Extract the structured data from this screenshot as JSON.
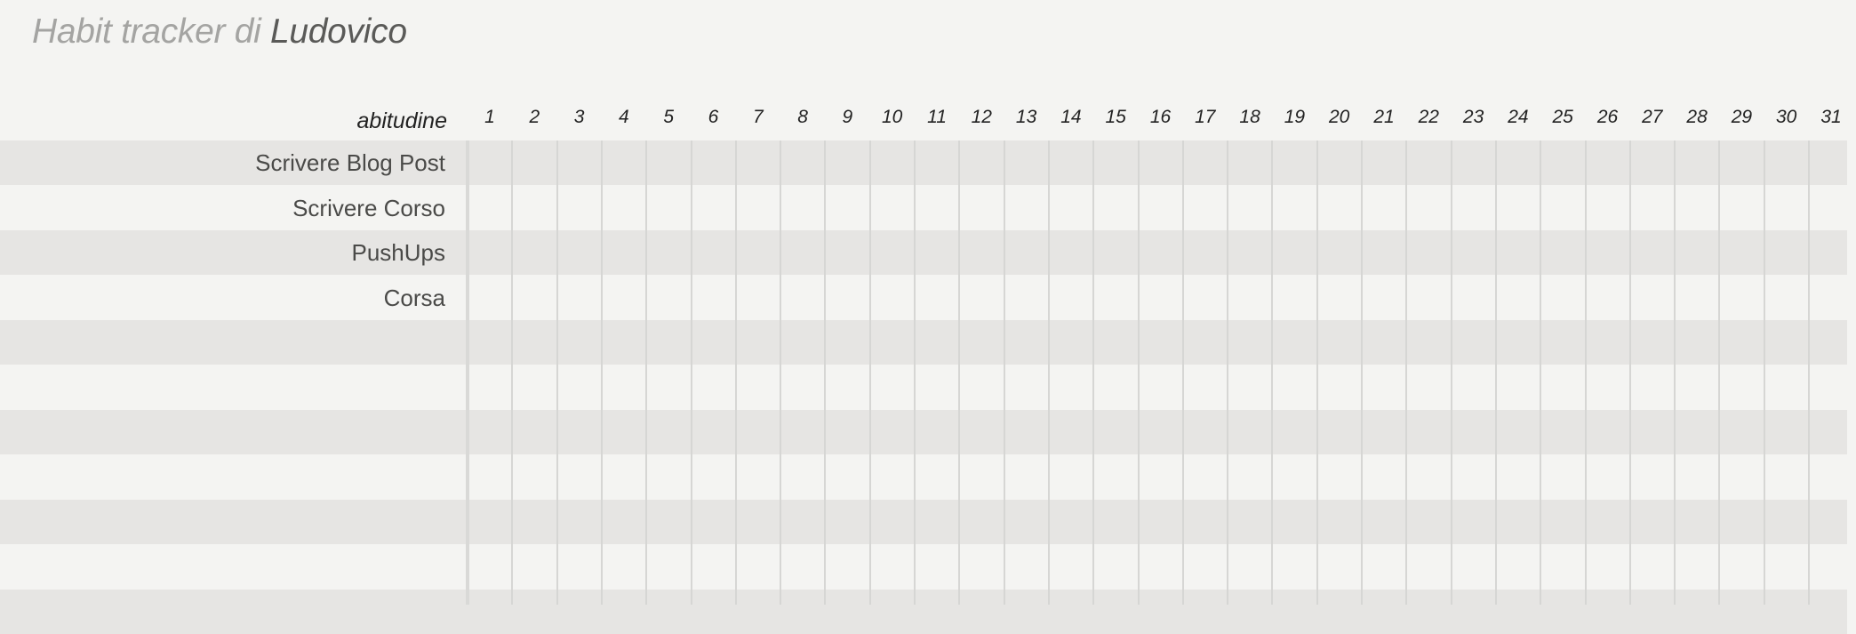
{
  "title": {
    "prefix": "Habit tracker di",
    "name": "Ludovico"
  },
  "table": {
    "habit_column_label": "abitudine",
    "days": [
      "1",
      "2",
      "3",
      "4",
      "5",
      "6",
      "7",
      "8",
      "9",
      "10",
      "11",
      "12",
      "13",
      "14",
      "15",
      "16",
      "17",
      "18",
      "19",
      "20",
      "21",
      "22",
      "23",
      "24",
      "25",
      "26",
      "27",
      "28",
      "29",
      "30",
      "31"
    ],
    "rows": [
      {
        "label": "Scrivere Blog Post"
      },
      {
        "label": "Scrivere Corso"
      },
      {
        "label": "PushUps"
      },
      {
        "label": "Corsa"
      },
      {
        "label": ""
      },
      {
        "label": ""
      },
      {
        "label": ""
      },
      {
        "label": ""
      },
      {
        "label": ""
      },
      {
        "label": ""
      },
      {
        "label": ""
      }
    ]
  },
  "colors": {
    "background": "#f4f4f2",
    "row_shade": "#e6e5e3",
    "grid_line": "#d6d6d4",
    "title_light": "#a4a4a2",
    "title_dark": "#5a5a58"
  }
}
